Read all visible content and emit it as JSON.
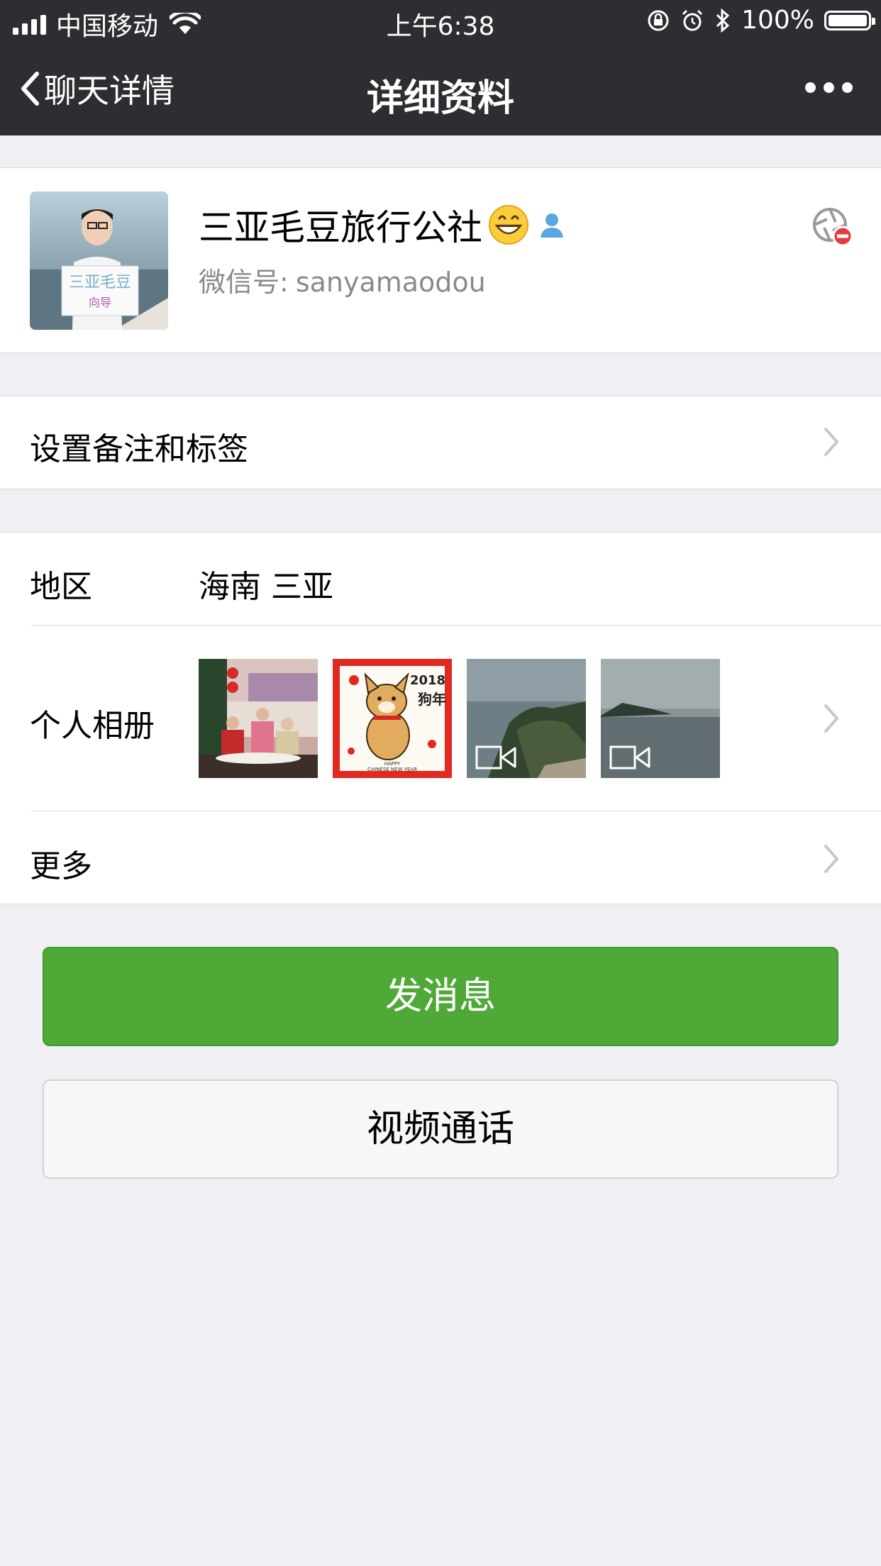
{
  "status": {
    "carrier": "中国移动",
    "time": "上午6:38",
    "battery_text": "100%",
    "battery_level": 1.0
  },
  "nav": {
    "back_label": "聊天详情",
    "title": "详细资料",
    "more_icon": "more-dots-icon"
  },
  "profile": {
    "name": "三亚毛豆旅行公社",
    "name_emoji": "grinning-face",
    "wechat_id_label": "微信号:",
    "wechat_id": "sanyamaodou",
    "avatar_sign_text": "三亚毛豆 向导"
  },
  "remark": {
    "label": "设置备注和标签"
  },
  "region": {
    "label": "地区",
    "value": "海南 三亚"
  },
  "album": {
    "label": "个人相册",
    "photos": [
      {
        "type": "photo",
        "desc": "group-photo"
      },
      {
        "type": "photo",
        "desc": "dog-new-year-card",
        "card_text": [
          "2018",
          "狗年",
          "HAPPY",
          "CHINESE NEW YEAR"
        ]
      },
      {
        "type": "video",
        "desc": "coastal-cliff"
      },
      {
        "type": "video",
        "desc": "sea-island"
      }
    ]
  },
  "more": {
    "label": "更多"
  },
  "buttons": {
    "send_message": "发消息",
    "video_call": "视频通话"
  },
  "colors": {
    "nav_bg": "#2e2e32",
    "primary_green": "#4fa937",
    "page_bg": "#efeff4"
  }
}
